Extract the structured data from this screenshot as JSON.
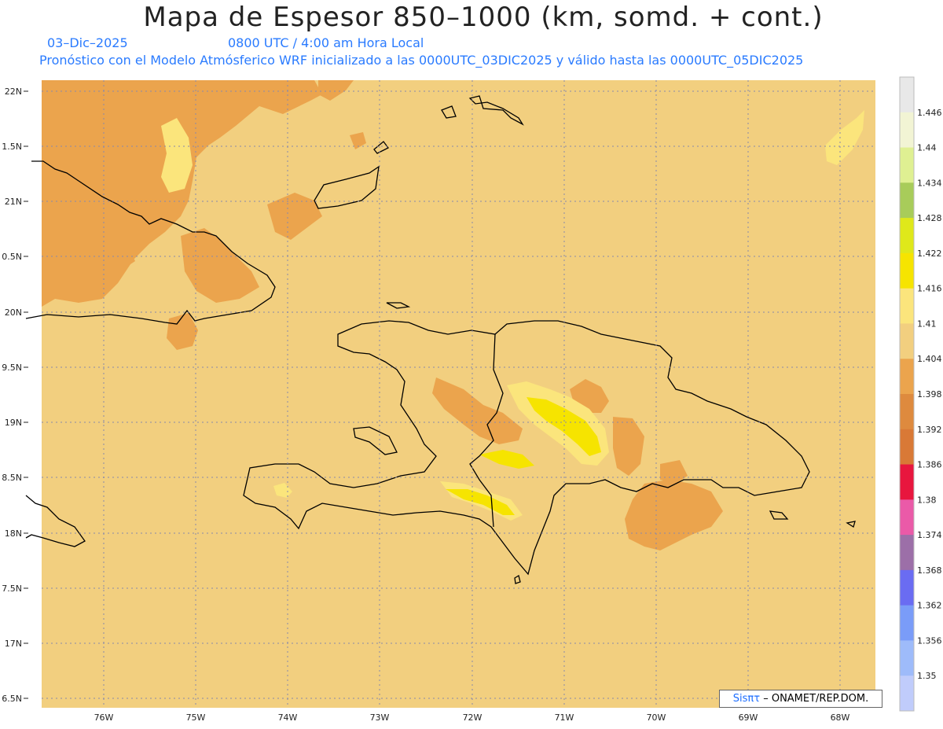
{
  "header": {
    "title": "Mapa de Espesor 850–1000 (km, somd. + cont.)",
    "date": "03–Dic–2025",
    "time": "0800 UTC / 4:00 am Hora Local",
    "description": "Pronóstico con el Modelo Atmósferico WRF inicializado a las 0000UTC_03DIC2025 y válido hasta las  0000UTC_05DIC2025"
  },
  "map": {
    "lat_ticks": [
      "22N",
      "1.5N",
      "21N",
      "0.5N",
      "20N",
      "9.5N",
      "19N",
      "8.5N",
      "18N",
      "7.5N",
      "17N",
      "6.5N"
    ],
    "lon_ticks": [
      "76W",
      "75W",
      "74W",
      "73W",
      "72W",
      "71W",
      "70W",
      "69W",
      "68W"
    ],
    "background_value_color": "#f2cf7f"
  },
  "colorbar": {
    "labels": [
      "1.446",
      "1.44",
      "1.434",
      "1.428",
      "1.422",
      "1.416",
      "1.41",
      "1.404",
      "1.398",
      "1.392",
      "1.386",
      "1.38",
      "1.374",
      "1.368",
      "1.362",
      "1.356",
      "1.35"
    ],
    "colors": [
      "#e8e8e8",
      "#f2f4d4",
      "#dff092",
      "#a8cc5a",
      "#dfe81a",
      "#f6e400",
      "#fbe57c",
      "#f2cf7f",
      "#eba44d",
      "#de8a3e",
      "#d97936",
      "#e8163e",
      "#ea5aa8",
      "#9c6fa8",
      "#6a6cf2",
      "#7a9cf8",
      "#9ebbfa",
      "#c0ccfb"
    ]
  },
  "credit": {
    "brand": "Sisπτ",
    "text": "– ONAMET/REP.DOM."
  }
}
